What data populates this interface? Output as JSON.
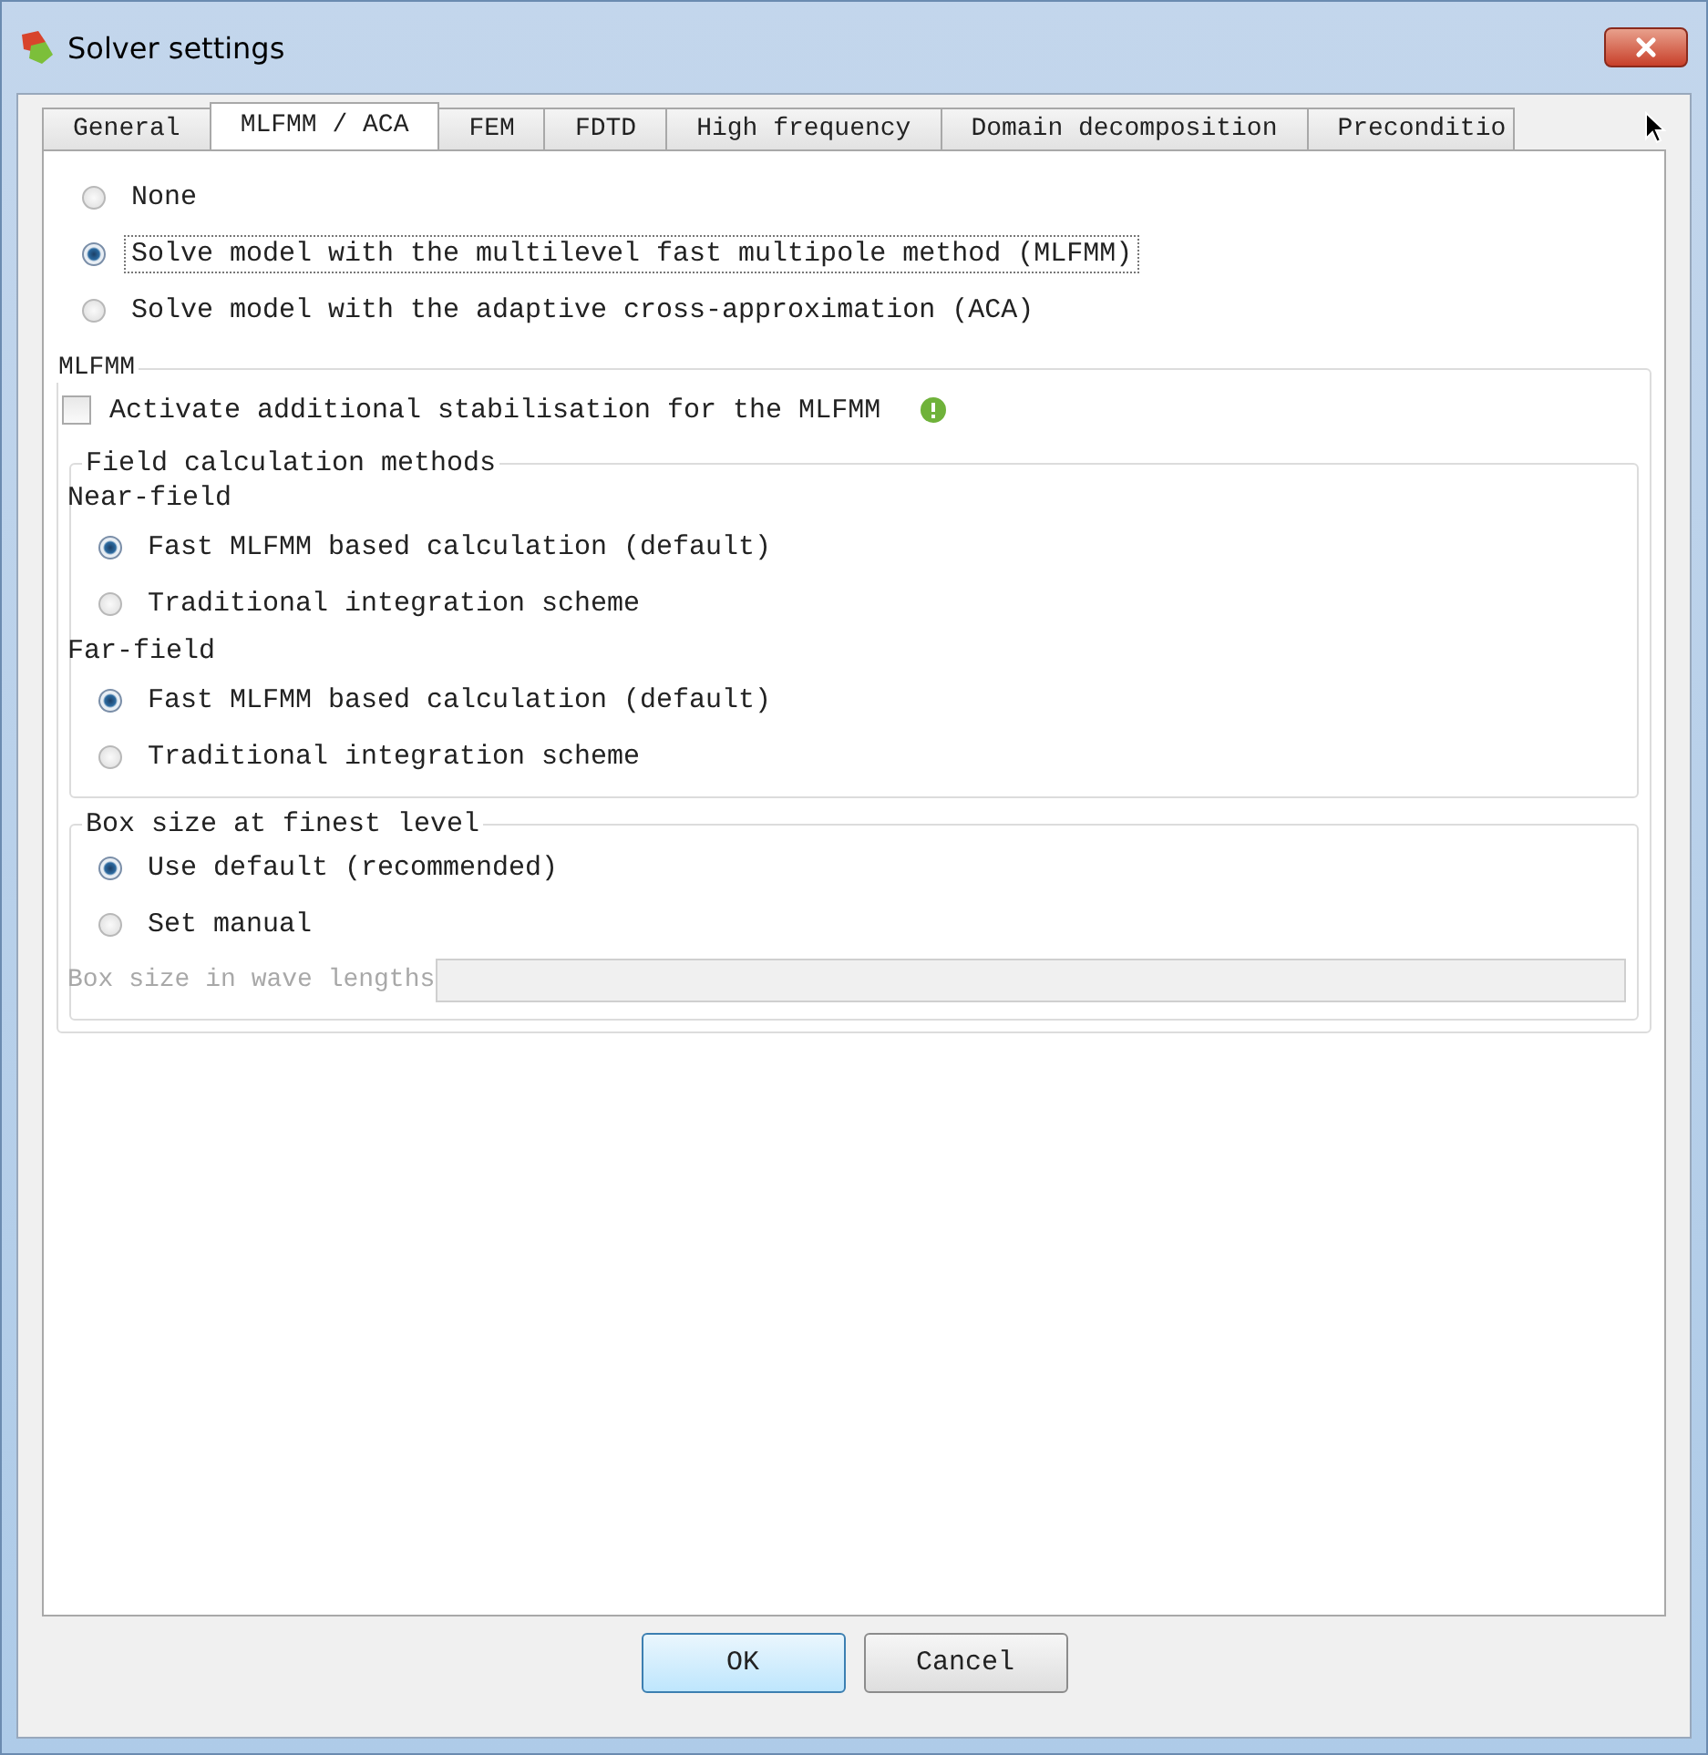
{
  "window": {
    "title": "Solver settings"
  },
  "tabs": [
    {
      "label": "General",
      "selected": false
    },
    {
      "label": "MLFMM / ACA",
      "selected": true
    },
    {
      "label": "FEM",
      "selected": false
    },
    {
      "label": "FDTD",
      "selected": false
    },
    {
      "label": "High frequency",
      "selected": false
    },
    {
      "label": "Domain decomposition",
      "selected": false
    },
    {
      "label": "Preconditio",
      "selected": false
    }
  ],
  "solver_options": [
    {
      "label": "None",
      "selected": false,
      "focused": false
    },
    {
      "label": "Solve model with the multilevel fast multipole method (MLFMM)",
      "selected": true,
      "focused": true
    },
    {
      "label": "Solve model with the adaptive cross-approximation (ACA)",
      "selected": false,
      "focused": false
    }
  ],
  "mlfmm": {
    "title": "MLFMM",
    "stabilisation": {
      "label": "Activate additional stabilisation for the MLFMM",
      "checked": false
    },
    "field_calculation": {
      "title": "Field calculation methods",
      "sections": [
        {
          "label": "Near-field",
          "options": [
            {
              "label": "Fast MLFMM based calculation (default)",
              "selected": true
            },
            {
              "label": "Traditional integration scheme",
              "selected": false
            }
          ]
        },
        {
          "label": "Far-field",
          "options": [
            {
              "label": "Fast MLFMM based calculation (default)",
              "selected": true
            },
            {
              "label": "Traditional integration scheme",
              "selected": false
            }
          ]
        }
      ]
    },
    "box_size": {
      "title": "Box size at finest level",
      "options": [
        {
          "label": "Use default (recommended)",
          "selected": true
        },
        {
          "label": "Set manual",
          "selected": false
        }
      ],
      "field": {
        "label": "Box size in wave lengths",
        "disabled": true
      }
    }
  },
  "buttons": [
    {
      "label": "OK",
      "default": true
    },
    {
      "label": "Cancel",
      "default": false
    }
  ]
}
